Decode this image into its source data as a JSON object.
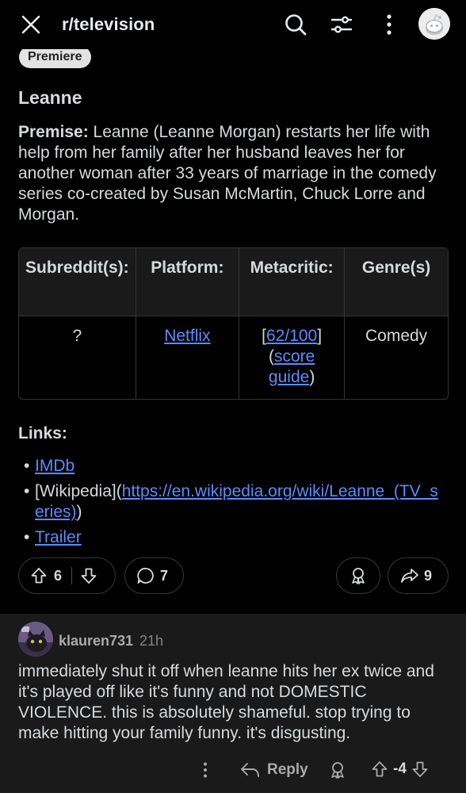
{
  "header": {
    "subreddit": "r/television",
    "icons": [
      "close-icon",
      "search-icon",
      "filter-icon",
      "more-vertical-icon",
      "user-avatar"
    ]
  },
  "post": {
    "flair": "Premiere",
    "heading": "Leanne",
    "premise_label": "Premise:",
    "premise_text": " Leanne (Leanne Morgan) restarts her life with help from her family after her husband leaves her for another woman after 33 years of marriage in the comedy series co-created by Susan McMartin, Chuck Lorre and Morgan.",
    "table": {
      "headers": [
        "Subreddit(s):",
        "Platform:",
        "Metacritic:",
        "Genre(s)"
      ],
      "row": {
        "subreddit": "?",
        "platform": "Netflix",
        "metacritic_open": "[",
        "metacritic_score": "62/100",
        "metacritic_close": "]",
        "score_guide_open": "(",
        "score_guide": "score guide",
        "score_guide_close": ")",
        "genre": "Comedy"
      }
    },
    "links_heading": "Links:",
    "links": {
      "imdb": "IMDb",
      "wikipedia_prefix": "[Wikipedia](",
      "wikipedia_url": "https://en.wikipedia.org/wiki/Leanne_(TV_series)",
      "wikipedia_suffix": ")",
      "trailer": "Trailer"
    },
    "actions": {
      "upvotes": "6",
      "comments": "7",
      "shares": "9"
    }
  },
  "comment": {
    "username": "klauren731",
    "time": "21h",
    "text": "immediately shut it off when leanne hits her ex twice and it's played off like it's funny and not DOMESTIC VIOLENCE. this is absolutely shameful. stop trying to make hitting your family funny. it's disgusting.",
    "reply_label": "Reply",
    "score": "-4"
  },
  "colors": {
    "background": "#000000",
    "comment_bg": "#1a1a1b",
    "link": "#5b8cff",
    "text": "#d7dadc",
    "muted": "#a8aaab"
  }
}
